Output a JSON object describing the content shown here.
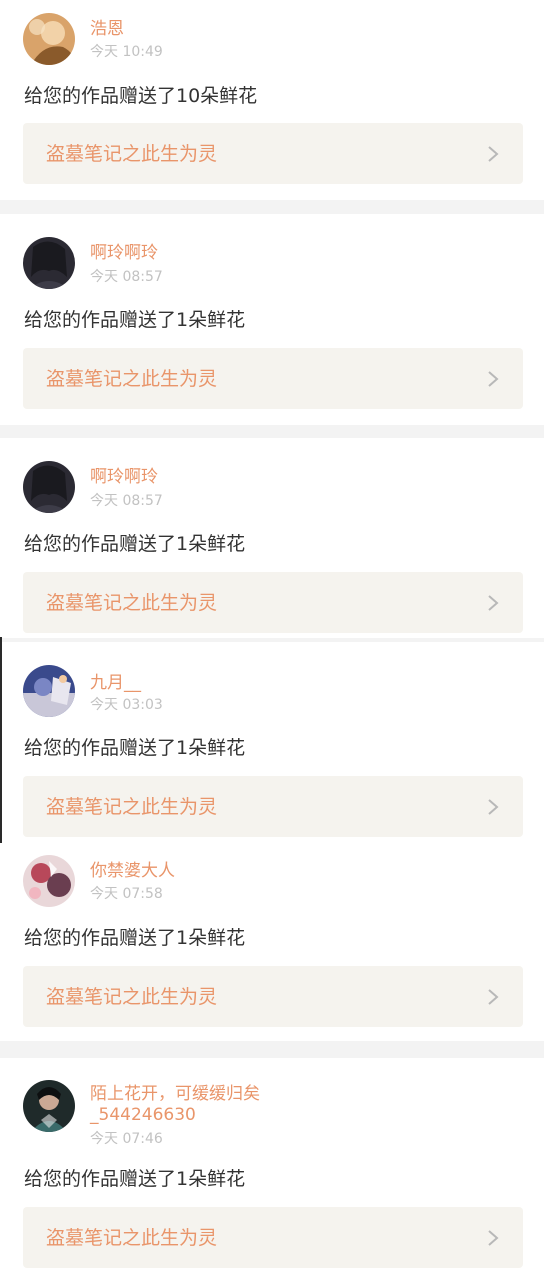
{
  "notifications": [
    {
      "username": "浩恩",
      "time": "今天 10:49",
      "message": "给您的作品赠送了10朵鲜花",
      "work_title": "盗墓笔记之此生为灵"
    },
    {
      "username": "啊玲啊玲",
      "time": "今天 08:57",
      "message": "给您的作品赠送了1朵鲜花",
      "work_title": "盗墓笔记之此生为灵"
    },
    {
      "username": "啊玲啊玲",
      "time": "今天 08:57",
      "message": "给您的作品赠送了1朵鲜花",
      "work_title": "盗墓笔记之此生为灵"
    },
    {
      "username": "九月__",
      "time": "今天 03:03",
      "message": "给您的作品赠送了1朵鲜花",
      "work_title": "盗墓笔记之此生为灵"
    },
    {
      "username": "你禁婆大人",
      "time": "今天 07:58",
      "message": "给您的作品赠送了1朵鲜花",
      "work_title": "盗墓笔记之此生为灵"
    },
    {
      "username": "陌上花开，可缓缓归矣",
      "username_line2": "_544246630",
      "time": "今天 07:46",
      "message": "给您的作品赠送了1朵鲜花",
      "work_title": "盗墓笔记之此生为灵"
    }
  ],
  "colors": {
    "accent": "#e9956a",
    "card_bg": "#f5f3ee",
    "divider": "#f3f3f3",
    "text": "#333333",
    "muted": "#c2c2c2"
  },
  "icons": {
    "avatar": "user-avatar-photo",
    "chevron": "chevron-right-icon"
  }
}
